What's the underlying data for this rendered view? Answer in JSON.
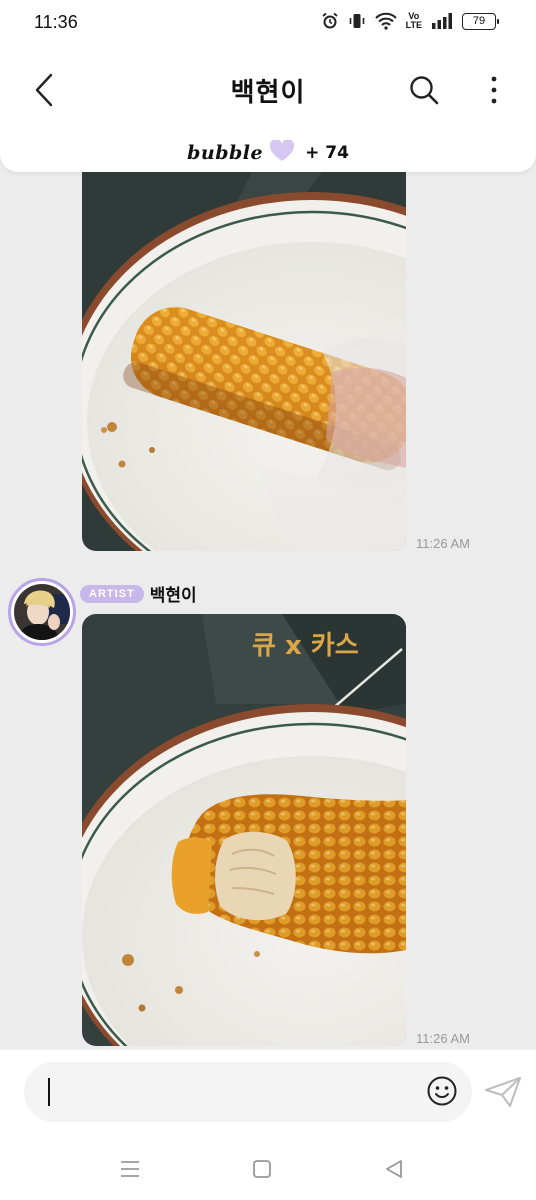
{
  "status_bar": {
    "time": "11:36",
    "battery": "79"
  },
  "header": {
    "title": "백현이",
    "bubble_brand": "bubble",
    "bubble_count": "+ 74"
  },
  "messages": [
    {
      "type": "photo",
      "timestamp": "11:26 AM"
    },
    {
      "sender": {
        "badge": "ARTIST",
        "name": "백현이"
      },
      "type": "photo",
      "timestamp": "11:26 AM",
      "box_text": "큐 x 카스"
    }
  ],
  "input": {
    "value": "",
    "placeholder": ""
  },
  "colors": {
    "artist_badge": "#c8b7e9",
    "avatar_ring": "#b8a4e6",
    "heart": "#d6c6f2",
    "plate_rim": "#3b5a4d"
  }
}
